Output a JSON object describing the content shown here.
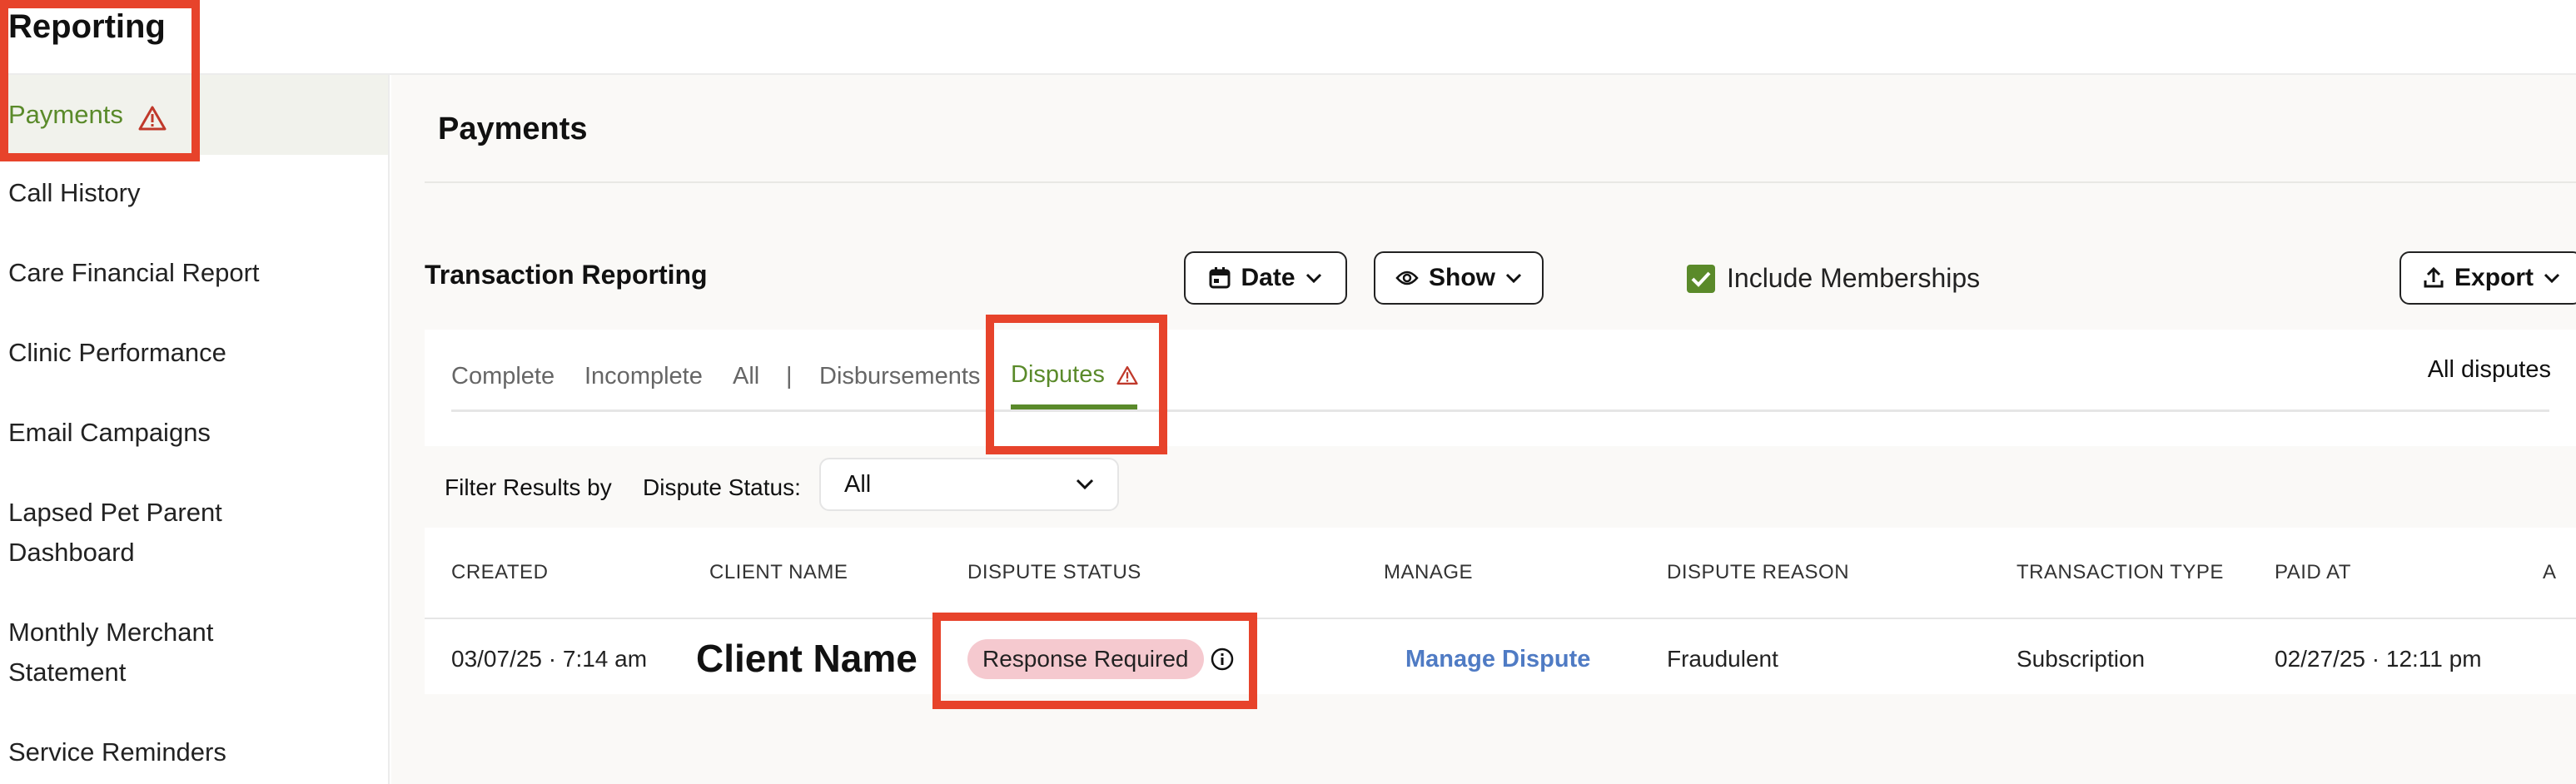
{
  "app": {
    "title": "Reporting"
  },
  "sidebar": {
    "items": [
      {
        "label": "Payments",
        "active": true,
        "warning": true
      },
      {
        "label": "Call History"
      },
      {
        "label": "Care Financial Report"
      },
      {
        "label": "Clinic Performance"
      },
      {
        "label": "Email Campaigns"
      },
      {
        "label": "Lapsed Pet Parent Dashboard"
      },
      {
        "label": "Monthly Merchant Statement"
      },
      {
        "label": "Service Reminders"
      }
    ]
  },
  "main": {
    "page_title": "Payments",
    "section_title": "Transaction Reporting",
    "include_memberships": {
      "label": "Include Memberships",
      "checked": true
    },
    "buttons": {
      "date": "Date",
      "show": "Show",
      "export": "Export"
    },
    "tabs": [
      {
        "label": "Complete"
      },
      {
        "label": "Incomplete"
      },
      {
        "label": "All"
      },
      {
        "label": "|"
      },
      {
        "label": "Disbursements"
      },
      {
        "label": "Disputes",
        "active": true,
        "warning": true
      }
    ],
    "all_disputes": "All disputes",
    "filter": {
      "label": "Filter Results by",
      "status_label": "Dispute Status:",
      "status_value": "All"
    },
    "table": {
      "headers": [
        "CREATED",
        "CLIENT NAME",
        "DISPUTE STATUS",
        "MANAGE",
        "DISPUTE REASON",
        "TRANSACTION TYPE",
        "PAID AT",
        "A"
      ],
      "rows": [
        {
          "created": "03/07/25 · 7:14 am",
          "client_name": "Client Name",
          "dispute_status": "Response Required",
          "manage": "Manage Dispute",
          "dispute_reason": "Fraudulent",
          "transaction_type": "Subscription",
          "paid_at": "02/27/25 · 12:11 pm"
        }
      ]
    }
  },
  "colors": {
    "accent_green": "#5a8a2a",
    "link_blue": "#4f7bc4",
    "badge_pink": "#f5c9cf",
    "highlight_red": "#e7432b",
    "warning_red": "#c0392b"
  }
}
